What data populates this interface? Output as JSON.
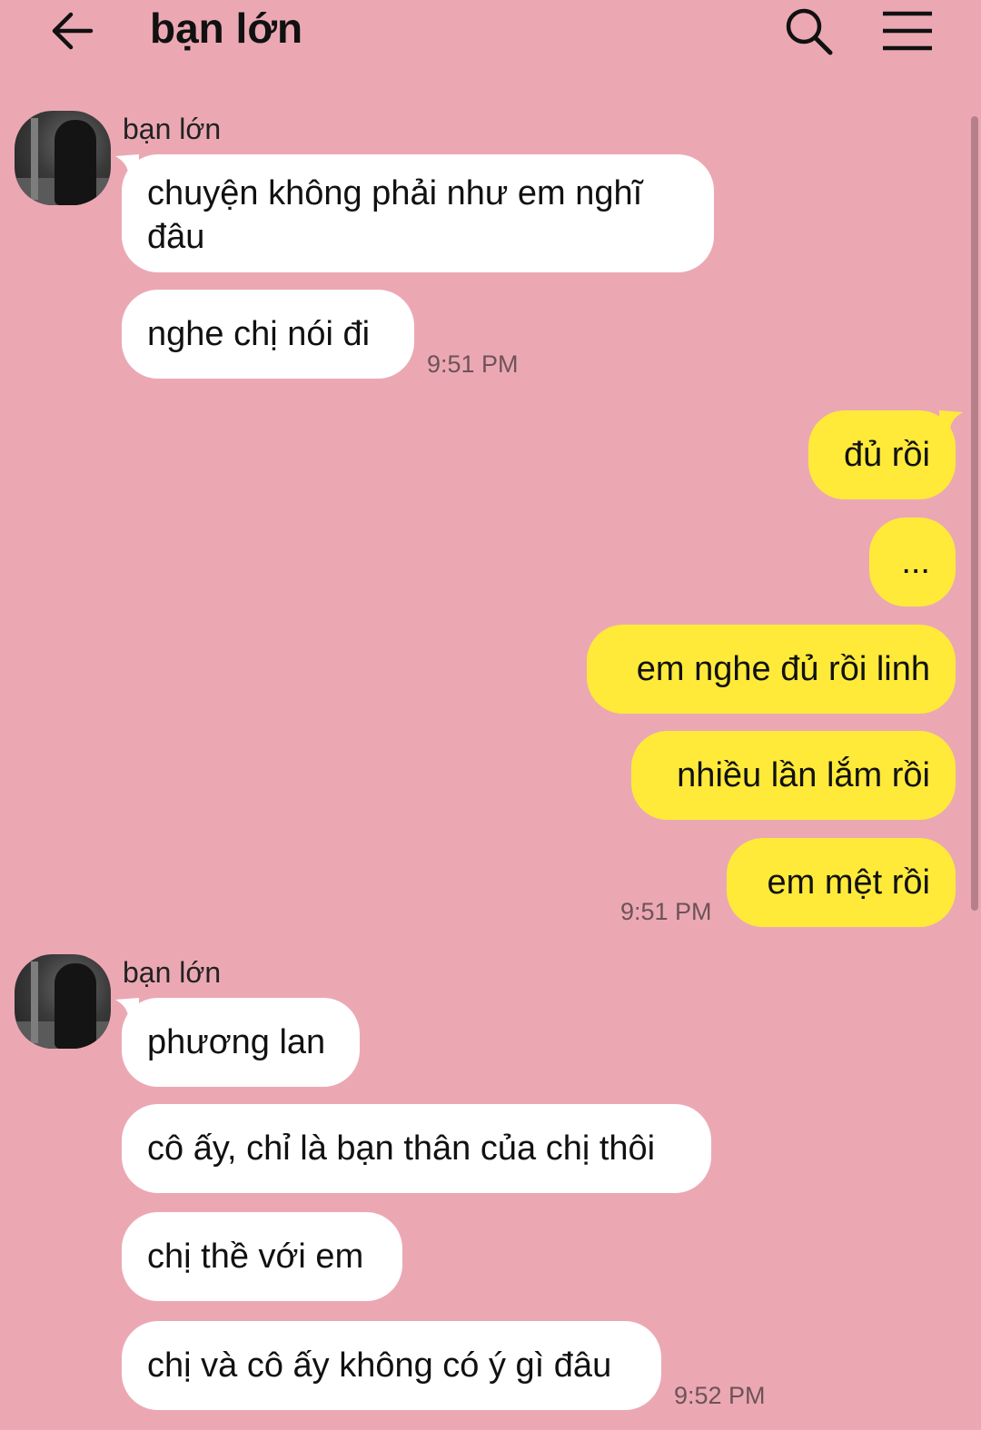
{
  "header": {
    "title": "bạn lớn",
    "back_icon": "arrow-left-icon",
    "search_icon": "search-icon",
    "menu_icon": "hamburger-menu-icon"
  },
  "colors": {
    "background": "#eba8b3",
    "incoming_bubble": "#ffffff",
    "outgoing_bubble": "#ffea3a",
    "text": "#111111",
    "timestamp": "#6d5358"
  },
  "groups": [
    {
      "sender": "bạn lớn",
      "direction": "in",
      "messages": [
        "chuyện không phải như em nghĩ đâu",
        "nghe chị nói đi"
      ],
      "time": "9:51 PM"
    },
    {
      "direction": "out",
      "messages": [
        "đủ rồi",
        "...",
        "em nghe đủ rồi linh",
        "nhiều lần lắm rồi",
        "em mệt rồi"
      ],
      "time": "9:51 PM"
    },
    {
      "sender": "bạn lớn",
      "direction": "in",
      "messages": [
        "phương lan",
        "cô ấy, chỉ là bạn thân của chị thôi",
        "chị thề với em",
        "chị và cô ấy không có ý gì đâu"
      ],
      "time": "9:52 PM"
    }
  ]
}
